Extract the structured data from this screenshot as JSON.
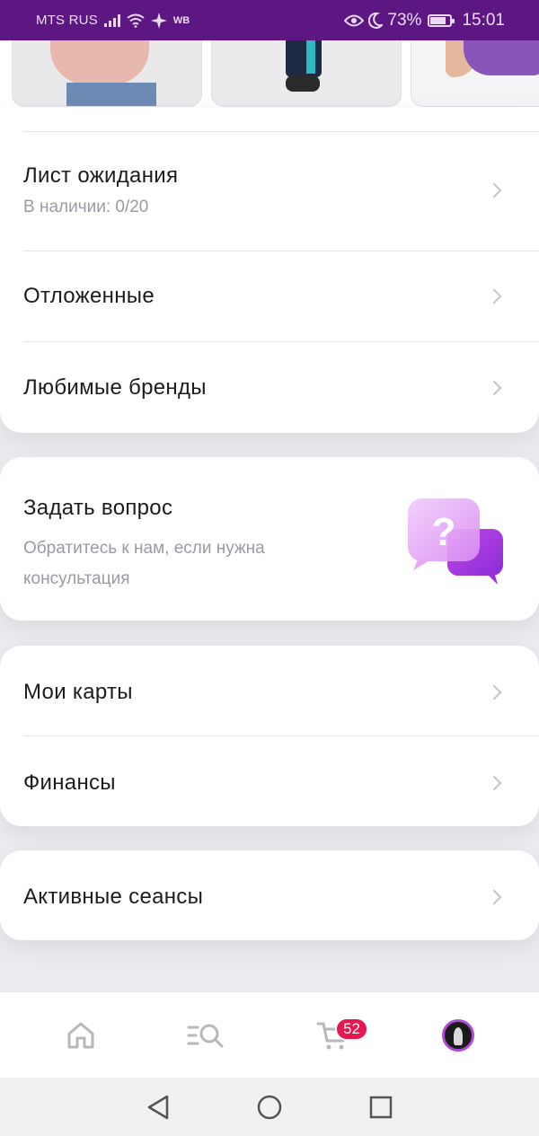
{
  "status_bar": {
    "carrier": "MTS RUS",
    "app_badge": "WB",
    "battery": "73%",
    "time": "15:01"
  },
  "menu_top": [
    {
      "title": "Лист ожидания",
      "subtitle": "В наличии: 0/20"
    },
    {
      "title": "Отложенные"
    },
    {
      "title": "Любимые бренды"
    }
  ],
  "ask": {
    "title": "Задать вопрос",
    "subtitle": "Обратитесь к нам, если нужна консультация"
  },
  "menu_finance": [
    {
      "title": "Мои карты"
    },
    {
      "title": "Финансы"
    }
  ],
  "menu_sessions": [
    {
      "title": "Активные сеансы"
    }
  ],
  "bottom_nav": {
    "cart_count": "52"
  },
  "colors": {
    "brand": "#5d1783",
    "badge": "#e8154f",
    "accent": "#b04ad6"
  },
  "icons": [
    "home-icon",
    "catalog-search-icon",
    "cart-icon",
    "profile-avatar",
    "chevron-right-icon",
    "question-bubble-icon"
  ]
}
